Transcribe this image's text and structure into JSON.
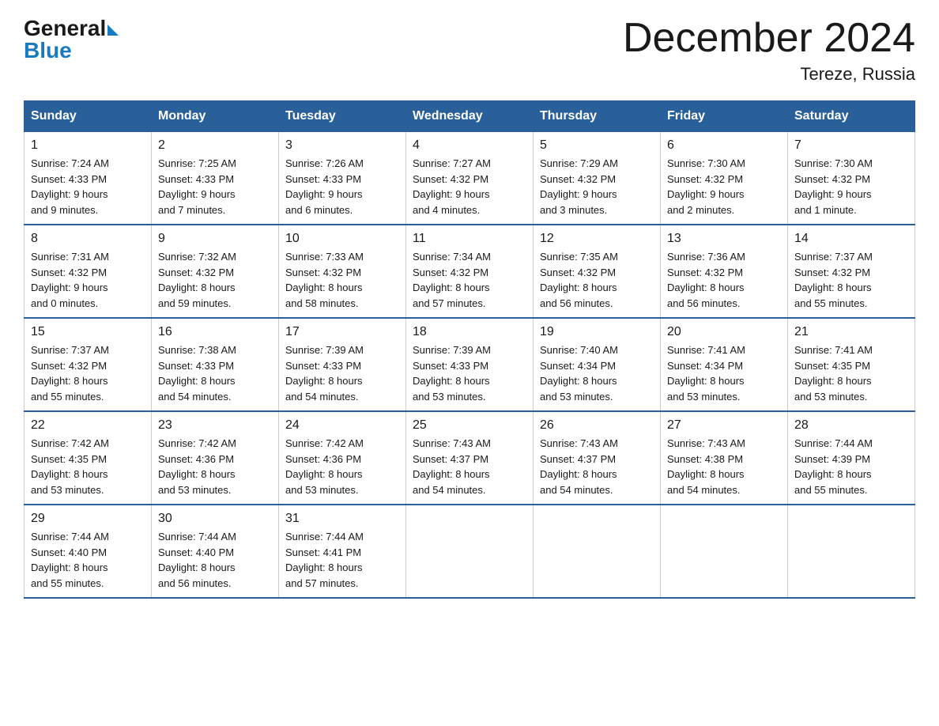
{
  "logo": {
    "general": "General",
    "arrow_color": "#1a7abf",
    "blue": "Blue"
  },
  "title": "December 2024",
  "subtitle": "Tereze, Russia",
  "days_of_week": [
    "Sunday",
    "Monday",
    "Tuesday",
    "Wednesday",
    "Thursday",
    "Friday",
    "Saturday"
  ],
  "weeks": [
    [
      {
        "day": "1",
        "sunrise": "7:24 AM",
        "sunset": "4:33 PM",
        "daylight": "9 hours and 9 minutes."
      },
      {
        "day": "2",
        "sunrise": "7:25 AM",
        "sunset": "4:33 PM",
        "daylight": "9 hours and 7 minutes."
      },
      {
        "day": "3",
        "sunrise": "7:26 AM",
        "sunset": "4:33 PM",
        "daylight": "9 hours and 6 minutes."
      },
      {
        "day": "4",
        "sunrise": "7:27 AM",
        "sunset": "4:32 PM",
        "daylight": "9 hours and 4 minutes."
      },
      {
        "day": "5",
        "sunrise": "7:29 AM",
        "sunset": "4:32 PM",
        "daylight": "9 hours and 3 minutes."
      },
      {
        "day": "6",
        "sunrise": "7:30 AM",
        "sunset": "4:32 PM",
        "daylight": "9 hours and 2 minutes."
      },
      {
        "day": "7",
        "sunrise": "7:30 AM",
        "sunset": "4:32 PM",
        "daylight": "9 hours and 1 minute."
      }
    ],
    [
      {
        "day": "8",
        "sunrise": "7:31 AM",
        "sunset": "4:32 PM",
        "daylight": "9 hours and 0 minutes."
      },
      {
        "day": "9",
        "sunrise": "7:32 AM",
        "sunset": "4:32 PM",
        "daylight": "8 hours and 59 minutes."
      },
      {
        "day": "10",
        "sunrise": "7:33 AM",
        "sunset": "4:32 PM",
        "daylight": "8 hours and 58 minutes."
      },
      {
        "day": "11",
        "sunrise": "7:34 AM",
        "sunset": "4:32 PM",
        "daylight": "8 hours and 57 minutes."
      },
      {
        "day": "12",
        "sunrise": "7:35 AM",
        "sunset": "4:32 PM",
        "daylight": "8 hours and 56 minutes."
      },
      {
        "day": "13",
        "sunrise": "7:36 AM",
        "sunset": "4:32 PM",
        "daylight": "8 hours and 56 minutes."
      },
      {
        "day": "14",
        "sunrise": "7:37 AM",
        "sunset": "4:32 PM",
        "daylight": "8 hours and 55 minutes."
      }
    ],
    [
      {
        "day": "15",
        "sunrise": "7:37 AM",
        "sunset": "4:32 PM",
        "daylight": "8 hours and 55 minutes."
      },
      {
        "day": "16",
        "sunrise": "7:38 AM",
        "sunset": "4:33 PM",
        "daylight": "8 hours and 54 minutes."
      },
      {
        "day": "17",
        "sunrise": "7:39 AM",
        "sunset": "4:33 PM",
        "daylight": "8 hours and 54 minutes."
      },
      {
        "day": "18",
        "sunrise": "7:39 AM",
        "sunset": "4:33 PM",
        "daylight": "8 hours and 53 minutes."
      },
      {
        "day": "19",
        "sunrise": "7:40 AM",
        "sunset": "4:34 PM",
        "daylight": "8 hours and 53 minutes."
      },
      {
        "day": "20",
        "sunrise": "7:41 AM",
        "sunset": "4:34 PM",
        "daylight": "8 hours and 53 minutes."
      },
      {
        "day": "21",
        "sunrise": "7:41 AM",
        "sunset": "4:35 PM",
        "daylight": "8 hours and 53 minutes."
      }
    ],
    [
      {
        "day": "22",
        "sunrise": "7:42 AM",
        "sunset": "4:35 PM",
        "daylight": "8 hours and 53 minutes."
      },
      {
        "day": "23",
        "sunrise": "7:42 AM",
        "sunset": "4:36 PM",
        "daylight": "8 hours and 53 minutes."
      },
      {
        "day": "24",
        "sunrise": "7:42 AM",
        "sunset": "4:36 PM",
        "daylight": "8 hours and 53 minutes."
      },
      {
        "day": "25",
        "sunrise": "7:43 AM",
        "sunset": "4:37 PM",
        "daylight": "8 hours and 54 minutes."
      },
      {
        "day": "26",
        "sunrise": "7:43 AM",
        "sunset": "4:37 PM",
        "daylight": "8 hours and 54 minutes."
      },
      {
        "day": "27",
        "sunrise": "7:43 AM",
        "sunset": "4:38 PM",
        "daylight": "8 hours and 54 minutes."
      },
      {
        "day": "28",
        "sunrise": "7:44 AM",
        "sunset": "4:39 PM",
        "daylight": "8 hours and 55 minutes."
      }
    ],
    [
      {
        "day": "29",
        "sunrise": "7:44 AM",
        "sunset": "4:40 PM",
        "daylight": "8 hours and 55 minutes."
      },
      {
        "day": "30",
        "sunrise": "7:44 AM",
        "sunset": "4:40 PM",
        "daylight": "8 hours and 56 minutes."
      },
      {
        "day": "31",
        "sunrise": "7:44 AM",
        "sunset": "4:41 PM",
        "daylight": "8 hours and 57 minutes."
      },
      null,
      null,
      null,
      null
    ]
  ],
  "labels": {
    "sunrise": "Sunrise:",
    "sunset": "Sunset:",
    "daylight": "Daylight:"
  }
}
